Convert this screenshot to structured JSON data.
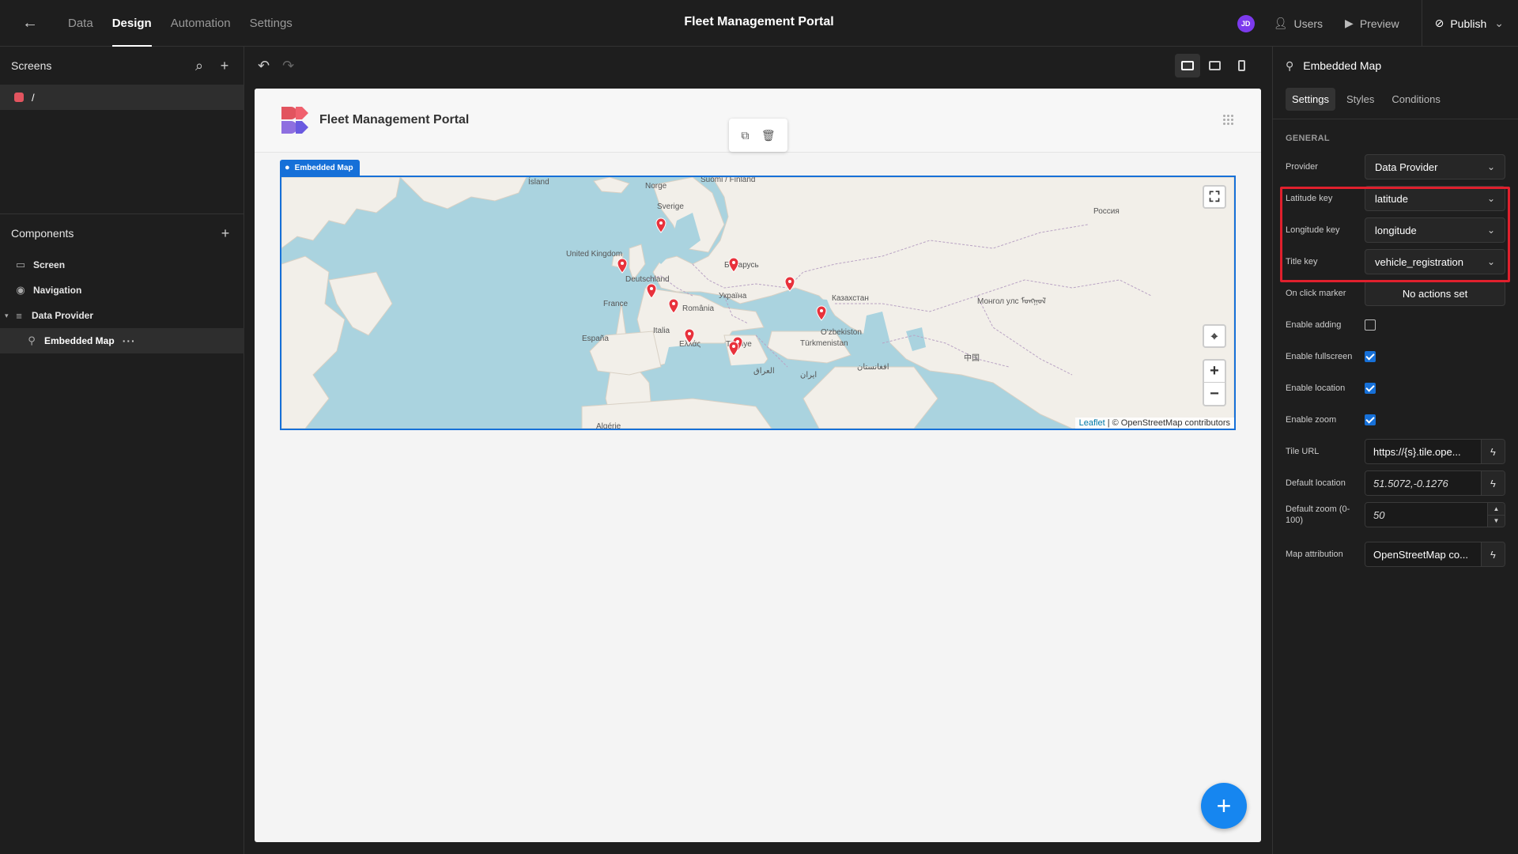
{
  "topbar": {
    "tabs": [
      "Data",
      "Design",
      "Automation",
      "Settings"
    ],
    "active_tab": "Design",
    "app_title": "Fleet Management Portal",
    "avatar_initials": "JD",
    "users_label": "Users",
    "preview_label": "Preview",
    "publish_label": "Publish"
  },
  "left": {
    "screens_title": "Screens",
    "screen_route": "/",
    "components_title": "Components",
    "tree": [
      {
        "label": "Screen",
        "icon": "screen-icon"
      },
      {
        "label": "Navigation",
        "icon": "eye-icon"
      },
      {
        "label": "Data Provider",
        "icon": "database-icon"
      },
      {
        "label": "Embedded Map",
        "icon": "map-pin-icon"
      }
    ]
  },
  "canvas": {
    "preview_title": "Fleet Management Portal",
    "map_label": "Embedded Map",
    "attribution_leaflet": "Leaflet",
    "attribution_rest": " | © OpenStreetMap contributors",
    "place_labels": [
      "Ísland",
      "Norge",
      "Suomi / Finland",
      "Sverige",
      "Россия",
      "United Kingdom",
      "Беларусь",
      "Deutschland",
      "Україна",
      "France",
      "România",
      "Казахстан",
      "Монгол улс ᠮᠣᠩᠭᠣᠯ",
      "España",
      "Italia",
      "Ελλάς",
      "Türkiye",
      "O'zbekiston",
      "Türkmenistan",
      "中国",
      "العراق",
      "ایران",
      "افغانستان",
      "Algérie"
    ]
  },
  "right": {
    "header_title": "Embedded Map",
    "tabs": [
      "Settings",
      "Styles",
      "Conditions"
    ],
    "section": "GENERAL",
    "provider_label": "Provider",
    "provider_value": "Data Provider",
    "latitude_label": "Latitude key",
    "latitude_value": "latitude",
    "longitude_label": "Longitude key",
    "longitude_value": "longitude",
    "title_label": "Title key",
    "title_value": "vehicle_registration",
    "onclick_label": "On click marker",
    "onclick_value": "No actions set",
    "enable_adding_label": "Enable adding",
    "enable_adding": false,
    "enable_fullscreen_label": "Enable fullscreen",
    "enable_fullscreen": true,
    "enable_location_label": "Enable location",
    "enable_location": true,
    "enable_zoom_label": "Enable zoom",
    "enable_zoom": true,
    "tile_url_label": "Tile URL",
    "tile_url_value": "https://{s}.tile.ope...",
    "default_location_label": "Default location",
    "default_location_value": "51.5072,-0.1276",
    "default_zoom_label": "Default zoom (0-100)",
    "default_zoom_value": "50",
    "map_attribution_label": "Map attribution",
    "map_attribution_value": "OpenStreetMap co..."
  },
  "colors": {
    "accent": "#1670d8",
    "highlight": "#e0202d",
    "marker": "#e8323c",
    "map_water": "#aad3df",
    "map_land": "#f2efe9"
  }
}
